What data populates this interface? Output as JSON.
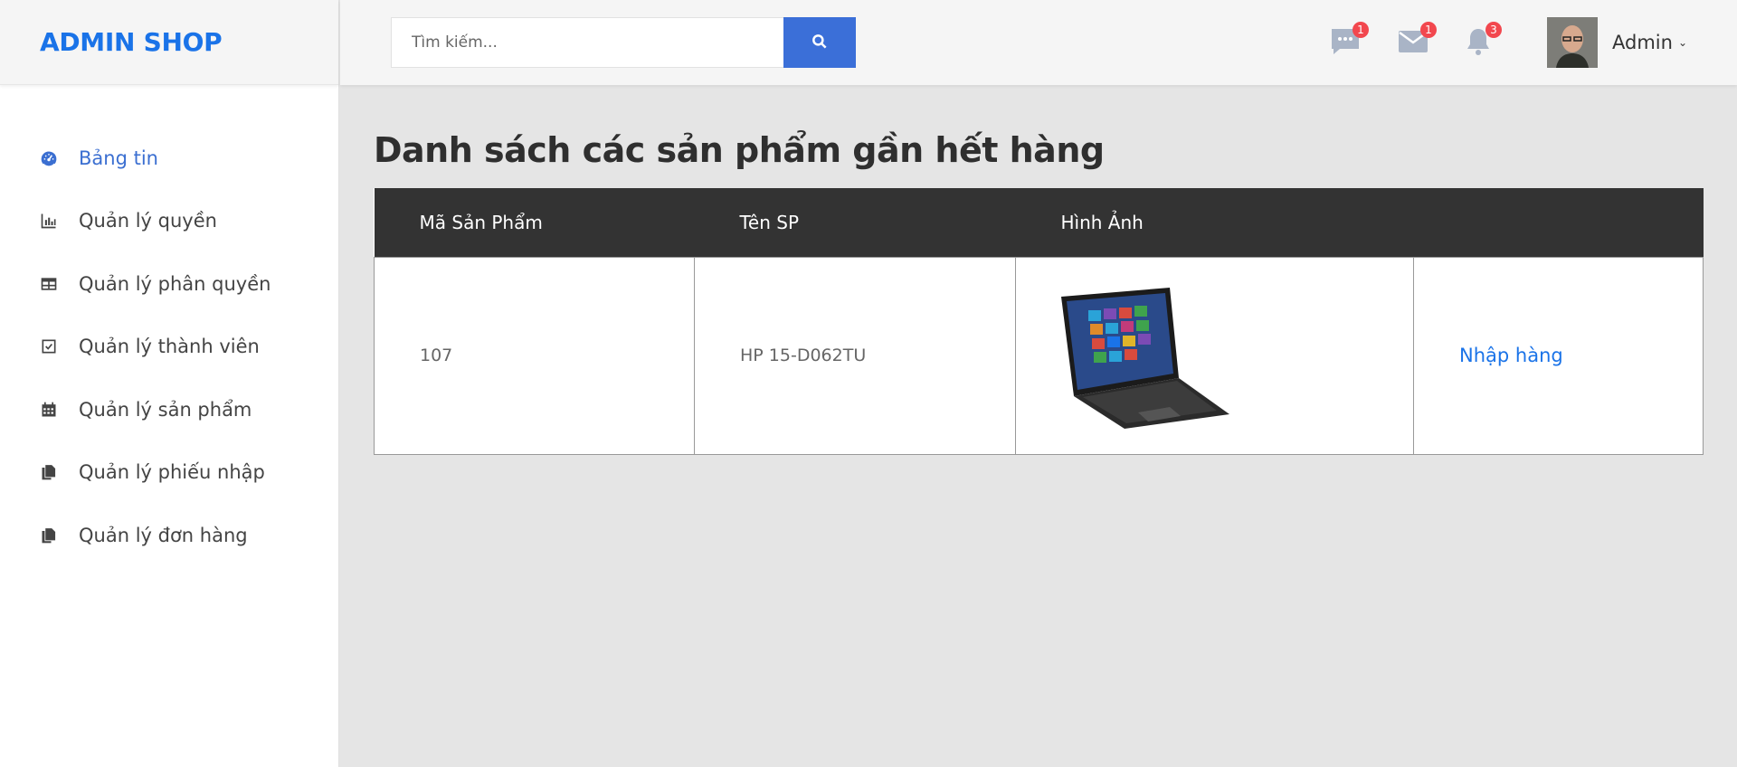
{
  "brand": {
    "name": "ADMIN SHOP"
  },
  "sidebar": {
    "items": [
      {
        "label": "Bảng tin",
        "icon": "dashboard-icon",
        "active": true
      },
      {
        "label": "Quản lý quyền",
        "icon": "bar-chart-icon",
        "active": false
      },
      {
        "label": "Quản lý phân quyền",
        "icon": "table-icon",
        "active": false
      },
      {
        "label": "Quản lý thành viên",
        "icon": "checkbox-icon",
        "active": false
      },
      {
        "label": "Quản lý sản phẩm",
        "icon": "calendar-icon",
        "active": false
      },
      {
        "label": "Quản lý phiếu nhập",
        "icon": "copy-icon",
        "active": false
      },
      {
        "label": "Quản lý đơn hàng",
        "icon": "copy-icon",
        "active": false
      }
    ]
  },
  "header": {
    "search": {
      "placeholder": "Tìm kiếm...",
      "button_icon": "search-icon"
    },
    "messages": {
      "icon": "chat-icon",
      "count": "1"
    },
    "mail": {
      "icon": "mail-icon",
      "count": "1"
    },
    "notifications": {
      "icon": "bell-icon",
      "count": "3"
    },
    "user": {
      "name": "Admin",
      "avatar": "avatar-icon"
    }
  },
  "main": {
    "title": "Danh sách các sản phẩm gần hết hàng",
    "table": {
      "columns": [
        "Mã Sản Phẩm",
        "Tên SP",
        "Hình Ảnh",
        ""
      ],
      "rows": [
        {
          "id": "107",
          "name": "HP 15-D062TU",
          "image": "laptop-image",
          "action": "Nhập hàng"
        }
      ]
    }
  },
  "colors": {
    "accent": "#3b6fd8",
    "brand": "#1a73e8",
    "table_header": "#333333",
    "badge": "#f2474e",
    "header_icons": "#a9b4c6"
  }
}
